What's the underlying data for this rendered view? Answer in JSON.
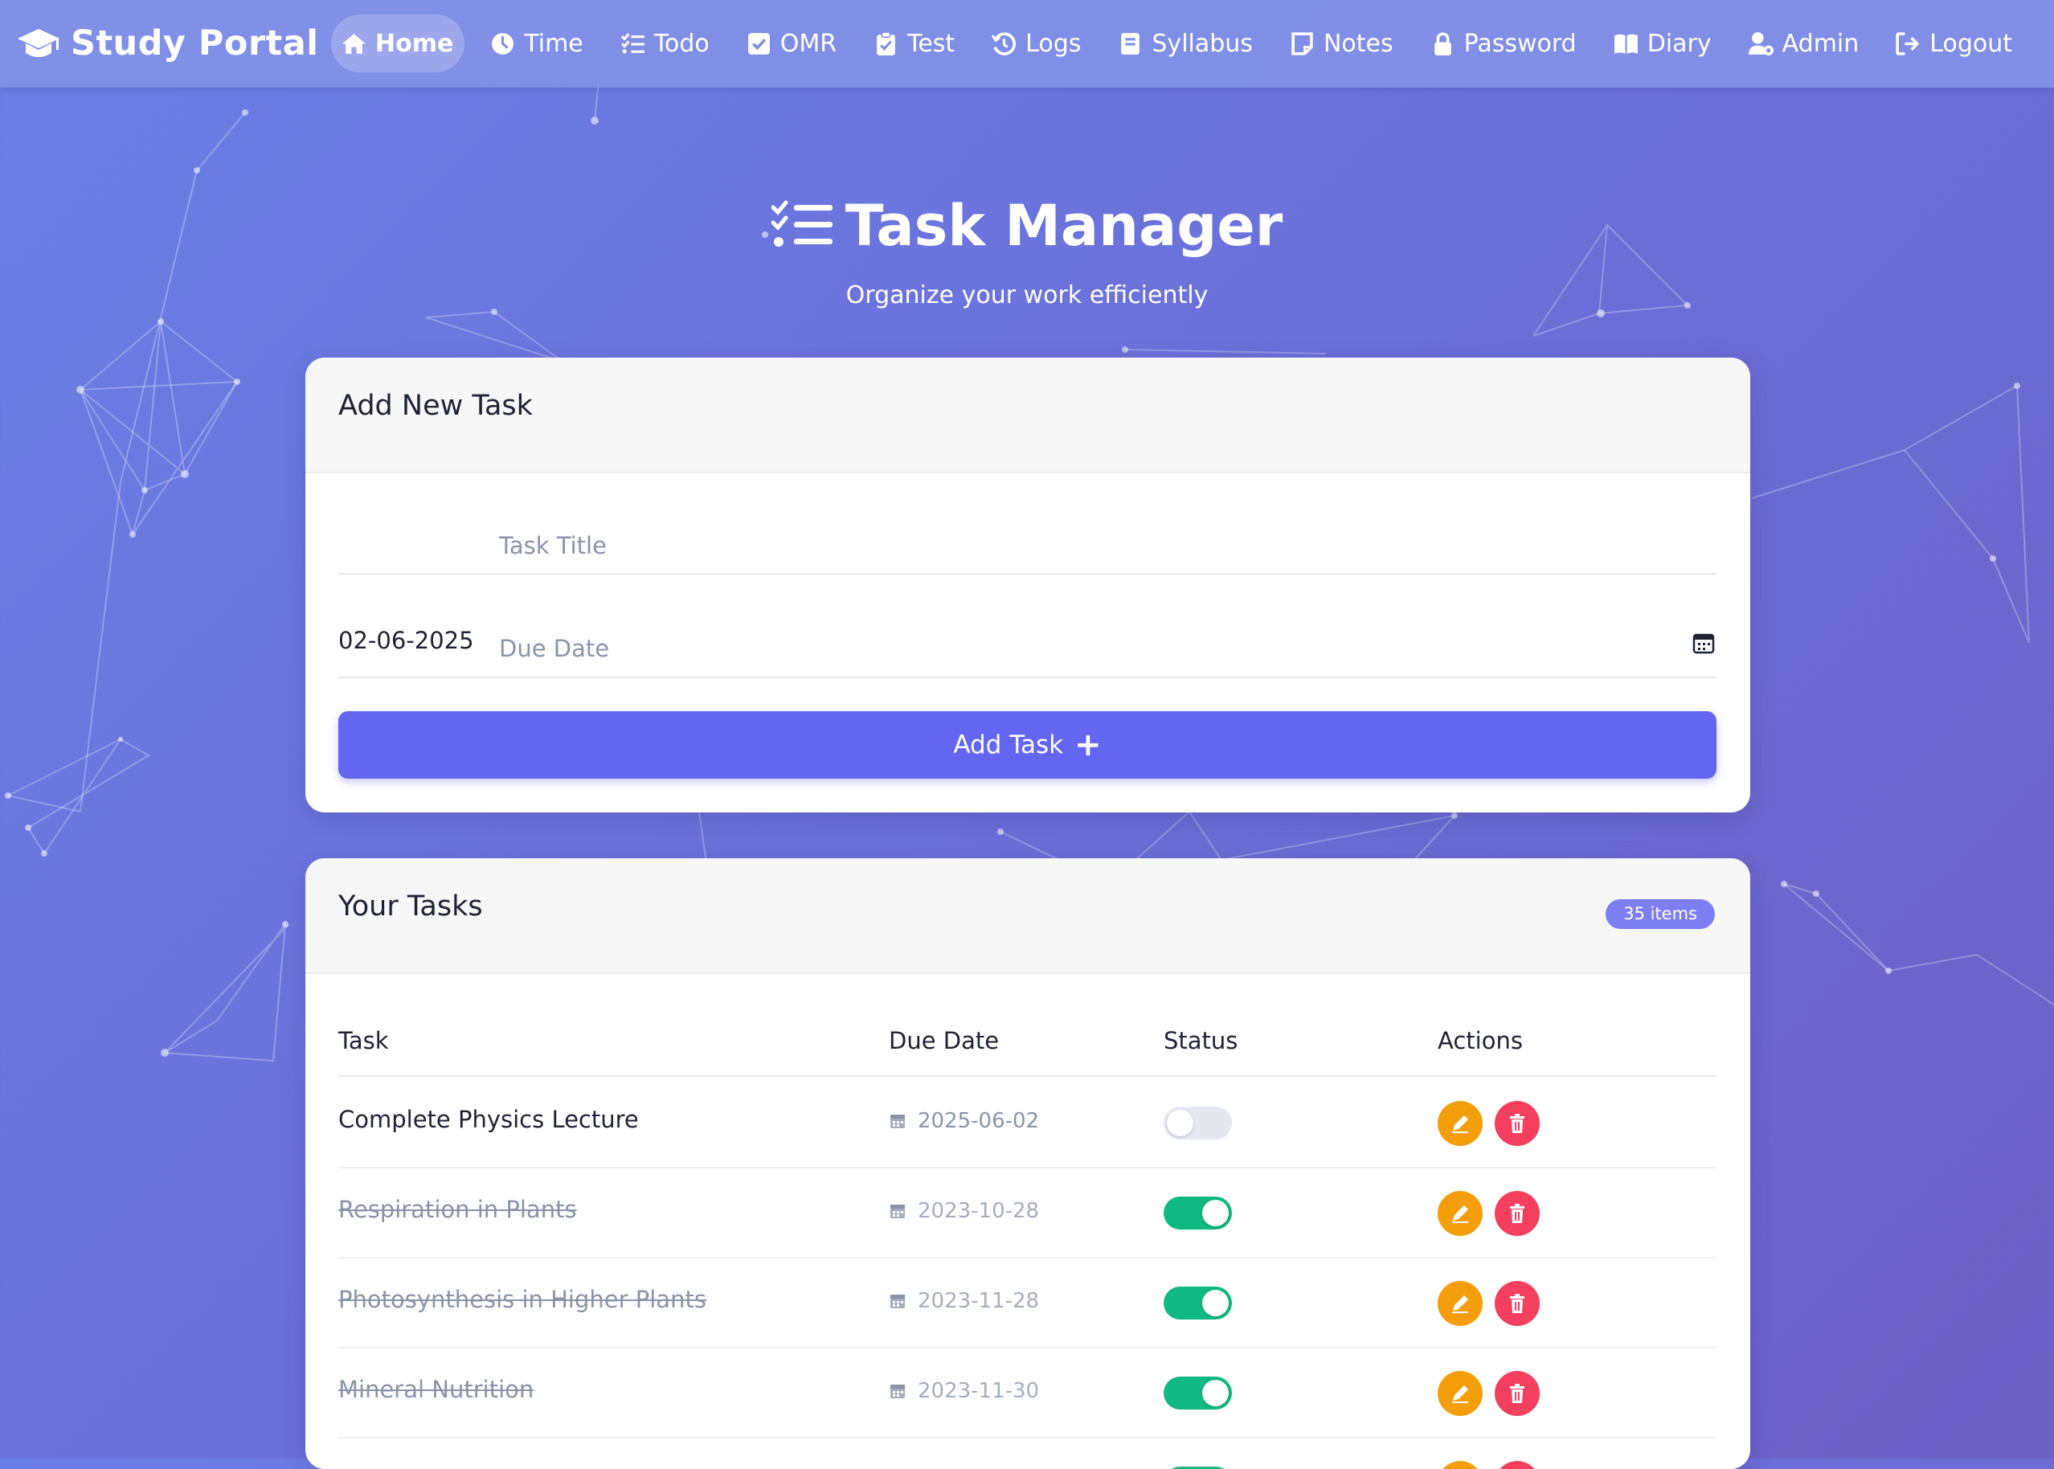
{
  "brand": {
    "name": "Study Portal",
    "icon": "graduation-cap-icon"
  },
  "nav": [
    {
      "label": "Home",
      "icon": "home-icon",
      "active": true
    },
    {
      "label": "Time",
      "icon": "clock-icon"
    },
    {
      "label": "Todo",
      "icon": "checklist-icon"
    },
    {
      "label": "OMR",
      "icon": "check-square-icon"
    },
    {
      "label": "Test",
      "icon": "clipboard-check-icon"
    },
    {
      "label": "Logs",
      "icon": "history-icon"
    },
    {
      "label": "Syllabus",
      "icon": "book-icon"
    },
    {
      "label": "Notes",
      "icon": "note-icon"
    },
    {
      "label": "Password",
      "icon": "lock-icon"
    },
    {
      "label": "Diary",
      "icon": "open-book-icon"
    },
    {
      "label": "Admin",
      "icon": "user-gear-icon"
    },
    {
      "label": "Logout",
      "icon": "logout-icon"
    }
  ],
  "hero": {
    "title": "Task Manager",
    "subtitle": "Organize your work efficiently",
    "icon": "list-check-icon"
  },
  "add_card": {
    "title": "Add New Task",
    "title_placeholder": "Task Title",
    "date_value": "02-06-2025",
    "date_placeholder": "Due Date",
    "button_label": "Add Task",
    "button_plus": "+"
  },
  "tasks_card": {
    "title": "Your Tasks",
    "count_badge": "35 items",
    "columns": {
      "task": "Task",
      "due": "Due Date",
      "status": "Status",
      "actions": "Actions"
    },
    "rows": [
      {
        "task": "Complete Physics Lecture",
        "due": "2025-06-02",
        "done": false
      },
      {
        "task": "Respiration in Plants",
        "due": "2023-10-28",
        "done": true
      },
      {
        "task": "Photosynthesis in Higher Plants",
        "due": "2023-11-28",
        "done": true
      },
      {
        "task": "Mineral Nutrition",
        "due": "2023-11-30",
        "done": true
      },
      {
        "task": "",
        "due": "",
        "done": true
      }
    ]
  },
  "colors": {
    "primary": "#6366f1",
    "badge": "#7c7ff2",
    "toggle_on": "#10b981",
    "edit": "#f59e0b",
    "delete": "#f43f5e"
  }
}
